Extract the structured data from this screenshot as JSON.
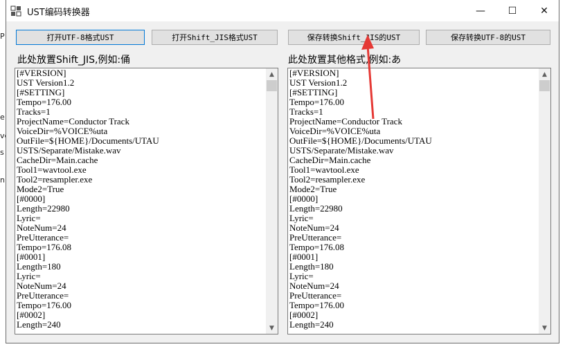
{
  "window": {
    "title": "UST编码转换器",
    "controls": {
      "minimize": "—",
      "maximize": "☐",
      "close": "✕"
    }
  },
  "left_strip_chars": [
    "P",
    "e",
    "ve",
    "s",
    "n"
  ],
  "toolbar": {
    "open_utf8": "打开UTF-8格式UST",
    "open_sjis": "打开Shift_JIS格式UST",
    "save_sjis": "保存转换Shift_JIS的UST",
    "save_utf8": "保存转换UTF-8的UST"
  },
  "left_panel": {
    "label": "此处放置Shift_JIS,例如:俑",
    "text": "[#VERSION]\nUST Version1.2\n[#SETTING]\nTempo=176.00\nTracks=1\nProjectName=Conductor Track\nVoiceDir=%VOICE%uta\nOutFile=${HOME}/Documents/UTAU\nUSTS/Separate/Mistake.wav\nCacheDir=Main.cache\nTool1=wavtool.exe\nTool2=resampler.exe\nMode2=True\n[#0000]\nLength=22980\nLyric=\nNoteNum=24\nPreUtterance=\nTempo=176.08\n[#0001]\nLength=180\nLyric=\nNoteNum=24\nPreUtterance=\nTempo=176.00\n[#0002]\nLength=240"
  },
  "right_panel": {
    "label": "此处放置其他格式,例如:あ",
    "text": "[#VERSION]\nUST Version1.2\n[#SETTING]\nTempo=176.00\nTracks=1\nProjectName=Conductor Track\nVoiceDir=%VOICE%uta\nOutFile=${HOME}/Documents/UTAU\nUSTS/Separate/Mistake.wav\nCacheDir=Main.cache\nTool1=wavtool.exe\nTool2=resampler.exe\nMode2=True\n[#0000]\nLength=22980\nLyric=\nNoteNum=24\nPreUtterance=\nTempo=176.08\n[#0001]\nLength=180\nLyric=\nNoteNum=24\nPreUtterance=\nTempo=176.00\n[#0002]\nLength=240"
  },
  "colors": {
    "annotation_arrow": "#e53935",
    "focus_border": "#0078d7"
  }
}
